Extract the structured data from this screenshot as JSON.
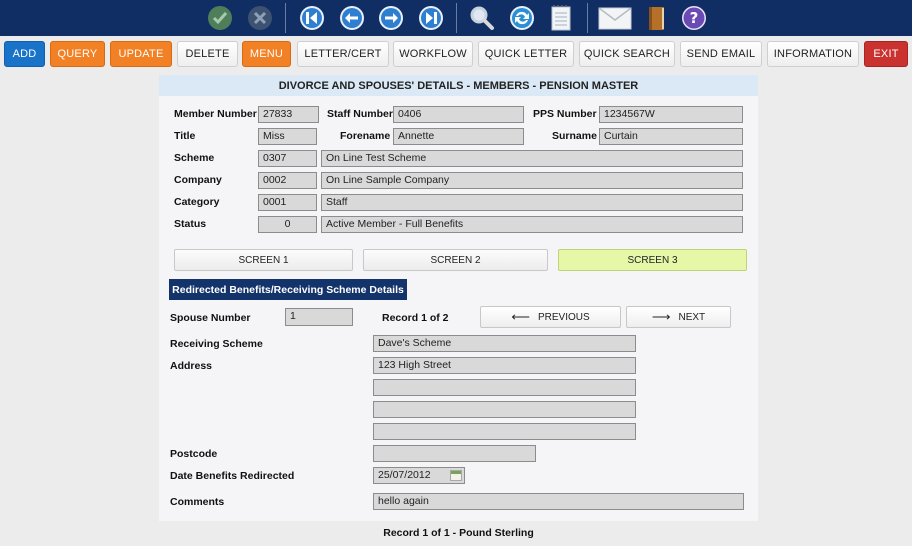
{
  "toolbar_icons": [
    {
      "name": "confirm-check-icon"
    },
    {
      "name": "cancel-x-icon"
    },
    {
      "name": "first-record-icon"
    },
    {
      "name": "previous-record-icon"
    },
    {
      "name": "next-record-icon"
    },
    {
      "name": "last-record-icon"
    },
    {
      "name": "search-magnifier-icon"
    },
    {
      "name": "refresh-icon"
    },
    {
      "name": "notepad-icon"
    },
    {
      "name": "envelope-icon"
    },
    {
      "name": "book-icon"
    },
    {
      "name": "help-icon"
    }
  ],
  "commands": {
    "add": "ADD",
    "query": "QUERY",
    "update": "UPDATE",
    "delete": "DELETE",
    "menu": "MENU",
    "letter_cert": "LETTER/CERT",
    "workflow": "WORKFLOW",
    "quick_letter": "QUICK LETTER",
    "quick_search": "QUICK SEARCH",
    "send_email": "SEND EMAIL",
    "information": "INFORMATION",
    "exit": "EXIT"
  },
  "colors": {
    "topbar": "#102d64",
    "add": "#1973c8",
    "orange": "#f28024",
    "exit": "#c9322e",
    "active_screen": "#e6f7a8",
    "section_header": "#13336b"
  },
  "form": {
    "title": "DIVORCE AND SPOUSES' DETAILS - MEMBERS - PENSION MASTER",
    "member_number": {
      "label": "Member Number",
      "value": "27833"
    },
    "staff_number": {
      "label": "Staff Number",
      "value": "0406"
    },
    "pps_number": {
      "label": "PPS Number",
      "value": "1234567W"
    },
    "title_field": {
      "label": "Title",
      "value": "Miss"
    },
    "forename": {
      "label": "Forename",
      "value": "Annette"
    },
    "surname": {
      "label": "Surname",
      "value": "Curtain"
    },
    "scheme": {
      "label": "Scheme",
      "code": "0307",
      "desc": "On Line Test Scheme"
    },
    "company": {
      "label": "Company",
      "code": "0002",
      "desc": "On Line Sample Company"
    },
    "category": {
      "label": "Category",
      "code": "0001",
      "desc": "Staff"
    },
    "status": {
      "label": "Status",
      "code": "0",
      "desc": "Active Member - Full Benefits"
    }
  },
  "screens": [
    "SCREEN 1",
    "SCREEN 2",
    "SCREEN 3"
  ],
  "active_screen": "SCREEN 3",
  "section": {
    "title": "Redirected Benefits/Receiving Scheme Details",
    "spouse_number": {
      "label": "Spouse Number",
      "value": "1"
    },
    "record_indicator": "Record 1 of 2",
    "previous": "PREVIOUS",
    "next": "NEXT",
    "receiving_scheme": {
      "label": "Receiving Scheme",
      "value": "Dave's Scheme"
    },
    "address": {
      "label": "Address",
      "lines": [
        "123 High Street",
        "",
        "",
        ""
      ]
    },
    "postcode": {
      "label": "Postcode",
      "value": ""
    },
    "date_redirected": {
      "label": "Date Benefits Redirected",
      "value": "25/07/2012"
    },
    "comments": {
      "label": "Comments",
      "value": "hello again"
    }
  },
  "footer": "Record 1 of 1 - Pound Sterling"
}
